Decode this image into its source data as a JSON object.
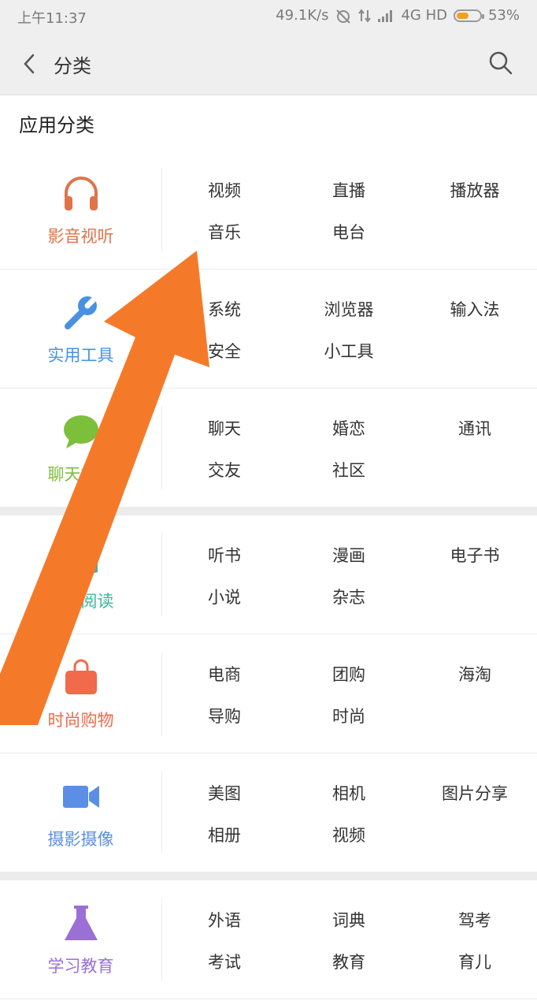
{
  "status_bar": {
    "time": "上午11:37",
    "net_speed": "49.1K/s",
    "network": "4G HD",
    "battery_percent": "53%",
    "battery_level": 0.53,
    "battery_color": "#f2a11f"
  },
  "header": {
    "title": "分类",
    "back_icon": "chevron-left-icon",
    "search_icon": "search-icon"
  },
  "section_title": "应用分类",
  "categories": [
    {
      "name": "影音视听",
      "icon": "headphones-icon",
      "color": "#e0734a",
      "items": [
        "视频",
        "直播",
        "播放器",
        "音乐",
        "电台"
      ]
    },
    {
      "name": "实用工具",
      "icon": "wrench-icon",
      "color": "#4a90e2",
      "items": [
        "系统",
        "浏览器",
        "输入法",
        "安全",
        "小工具"
      ]
    },
    {
      "name": "聊天社交",
      "icon": "chat-bubble-icon",
      "color": "#7cbf3b",
      "items": [
        "聊天",
        "婚恋",
        "通讯",
        "交友",
        "社区"
      ]
    },
    {
      "name": "图书阅读",
      "icon": "book-icon",
      "color": "#3fb59b",
      "items": [
        "听书",
        "漫画",
        "电子书",
        "小说",
        "杂志"
      ]
    },
    {
      "name": "时尚购物",
      "icon": "shopping-bag-icon",
      "color": "#f06a4b",
      "items": [
        "电商",
        "团购",
        "海淘",
        "导购",
        "时尚"
      ]
    },
    {
      "name": "摄影摄像",
      "icon": "video-camera-icon",
      "color": "#5b8fe6",
      "items": [
        "美图",
        "相机",
        "图片分享",
        "相册",
        "视频"
      ]
    },
    {
      "name": "学习教育",
      "icon": "flask-icon",
      "color": "#9b6fd6",
      "items": [
        "外语",
        "词典",
        "驾考",
        "考试",
        "教育",
        "育儿"
      ]
    }
  ],
  "overlay": {
    "arrow_color": "#f47a2a"
  }
}
